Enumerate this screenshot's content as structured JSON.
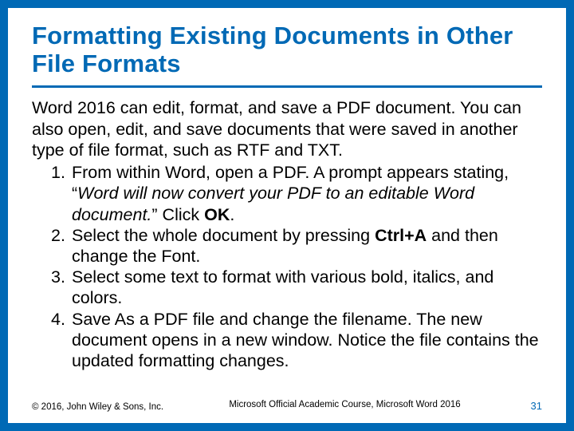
{
  "title": "Formatting Existing Documents in Other File Formats",
  "intro": "Word 2016 can edit, format, and save a PDF document. You can also open, edit, and save documents that were saved in another type of file format, such as RTF and TXT.",
  "steps": {
    "s1": {
      "pre": "From within Word, open a PDF. A prompt appears stating, “",
      "italic": "Word will now convert your PDF to an editable Word document.",
      "mid": "” Click ",
      "bold": "OK",
      "post": "."
    },
    "s2": {
      "pre": "Select the whole document by pressing ",
      "bold": "Ctrl+A",
      "post": " and then change the Font."
    },
    "s3": "Select some text to format with various bold, italics, and colors.",
    "s4": "Save As a PDF file and change the filename. The new document opens in a new window. Notice the file contains the updated formatting changes."
  },
  "footer": {
    "copyright": "© 2016, John Wiley & Sons, Inc.",
    "course": "Microsoft Official Academic Course, Microsoft Word 2016",
    "page": "31"
  }
}
